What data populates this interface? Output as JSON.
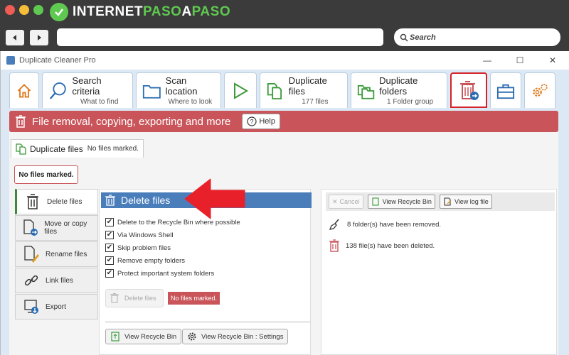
{
  "browser": {
    "brand_part1": "INTERNET",
    "brand_part2": "PASO",
    "brand_part3": "A",
    "brand_part4": "PASO",
    "search_placeholder": "Search"
  },
  "window": {
    "title": "Duplicate Cleaner Pro",
    "minimize": "—",
    "maximize": "☐",
    "close": "✕"
  },
  "toolbar": {
    "search_criteria": {
      "label": "Search criteria",
      "sub": "What to find"
    },
    "scan_location": {
      "label": "Scan location",
      "sub": "Where to look"
    },
    "duplicate_files": {
      "label": "Duplicate files",
      "sub": "177 files"
    },
    "duplicate_folders": {
      "label": "Duplicate folders",
      "sub": "1 Folder group"
    }
  },
  "banner": {
    "title": "File removal, copying, exporting and more",
    "help": "Help"
  },
  "subtab": {
    "label": "Duplicate files",
    "status": "No files marked."
  },
  "status_box": "No files marked.",
  "left_nav": [
    {
      "label": "Delete files"
    },
    {
      "label": "Move or copy files"
    },
    {
      "label": "Rename files"
    },
    {
      "label": "Link files"
    },
    {
      "label": "Export"
    }
  ],
  "delete_panel": {
    "header": "Delete files",
    "options": [
      {
        "label": "Delete to the Recycle Bin where possible",
        "checked": true
      },
      {
        "label": "Via Windows Shell",
        "checked": true
      },
      {
        "label": "Skip problem files",
        "checked": true
      },
      {
        "label": "Remove empty folders",
        "checked": true
      },
      {
        "label": "Protect important system folders",
        "checked": true
      }
    ],
    "delete_button": "Delete files",
    "no_files_marked": "No files marked.",
    "view_recycle_bin": "View Recycle Bin",
    "view_recycle_bin_settings": "View Recycle Bin : Settings"
  },
  "log_panel": {
    "cancel": "Cancel",
    "view_recycle_bin": "View Recycle Bin",
    "view_log": "View log file",
    "messages": [
      "8 folder(s) have been removed.",
      "138 file(s) have been deleted."
    ]
  },
  "colors": {
    "banner_red": "#c9555a",
    "accent_blue": "#4a7ebb",
    "highlight_red": "#d4242a",
    "brand_green": "#5fc850"
  }
}
